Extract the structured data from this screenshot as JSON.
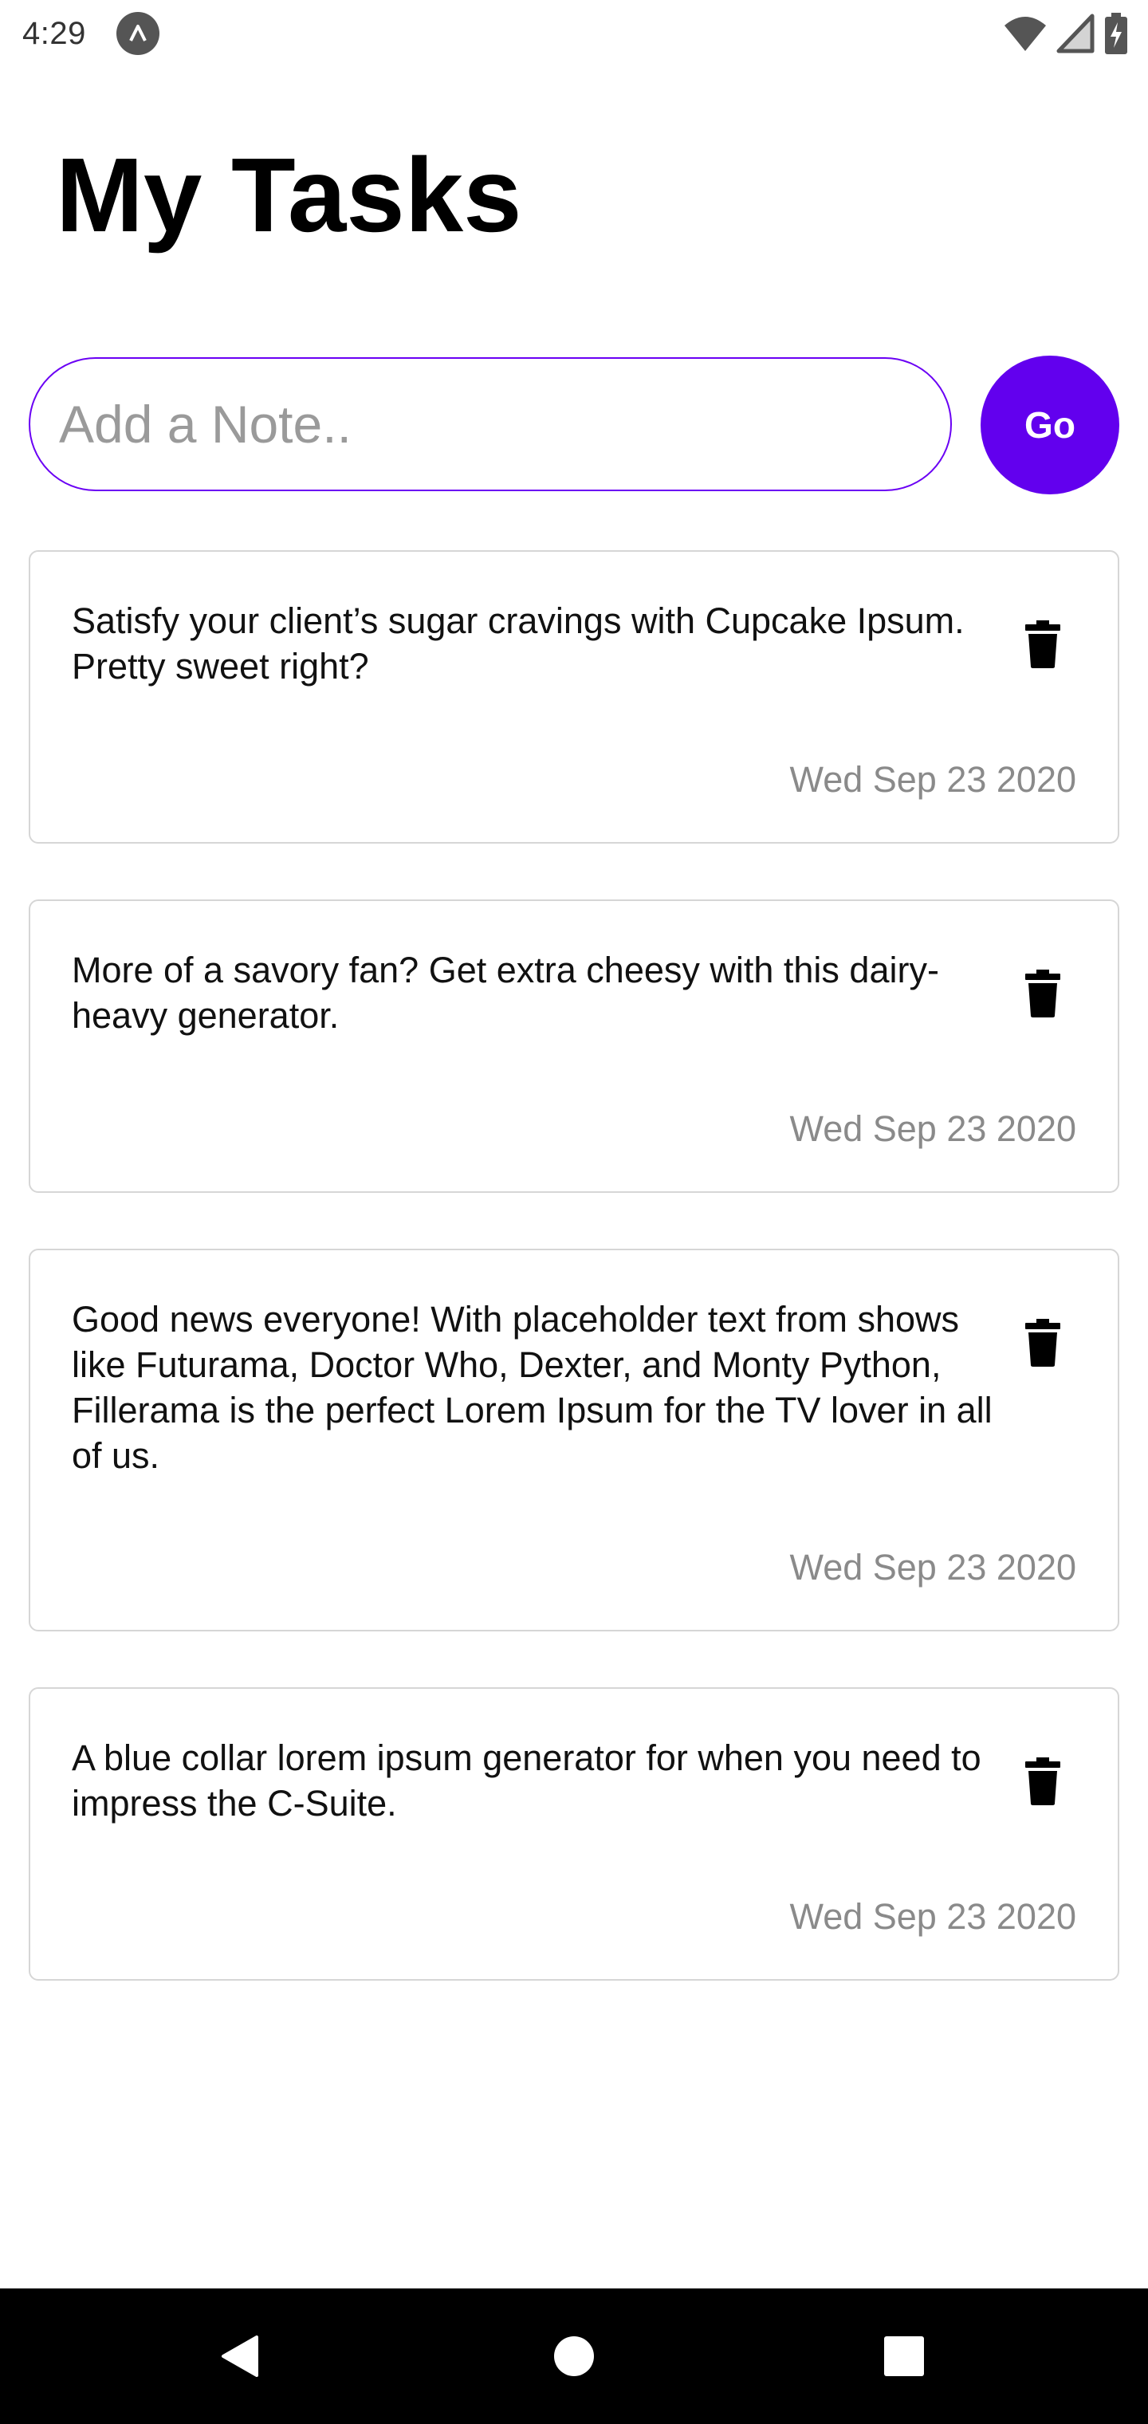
{
  "status_bar": {
    "time": "4:29"
  },
  "header": {
    "title": "My Tasks"
  },
  "composer": {
    "placeholder": "Add a Note..",
    "value": "",
    "go_label": "Go"
  },
  "colors": {
    "accent": "#6200ee",
    "card_border": "#d6d6d6",
    "date_text": "#8a8a8a"
  },
  "icons": {
    "delete": "trash-icon",
    "nav_back": "back-triangle-icon",
    "nav_home": "home-circle-icon",
    "nav_recents": "recents-square-icon"
  },
  "tasks": [
    {
      "text": "Satisfy your client’s sugar cravings with Cupcake Ipsum. Pretty sweet right?",
      "date": "Wed Sep 23 2020"
    },
    {
      "text": "More of a savory fan? Get extra cheesy with this dairy-heavy generator.",
      "date": "Wed Sep 23 2020"
    },
    {
      "text": "Good news everyone! With placeholder text from shows like Futurama, Doctor Who, Dexter, and Monty Python, Fillerama is the perfect Lorem Ipsum for the TV lover in all of us.",
      "date": "Wed Sep 23 2020"
    },
    {
      "text": "A blue collar lorem ipsum generator for when you need to impress the C-Suite.",
      "date": "Wed Sep 23 2020"
    }
  ]
}
